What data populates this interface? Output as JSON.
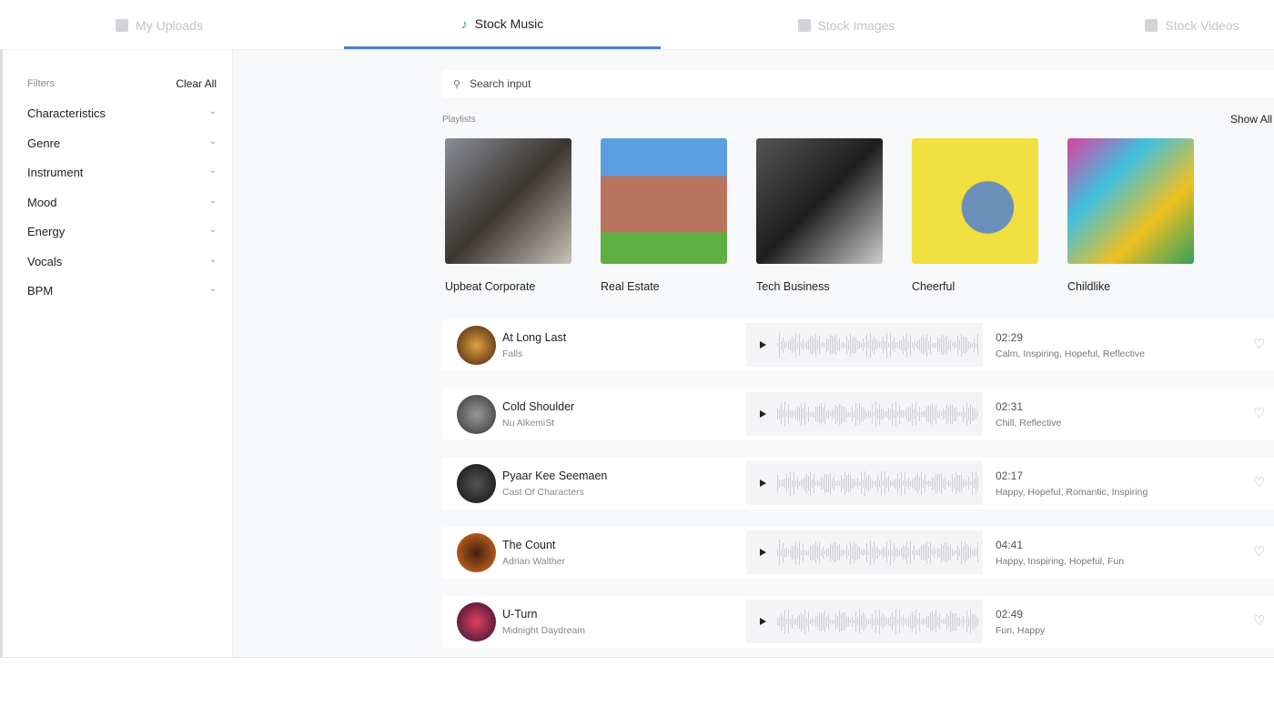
{
  "tabs": [
    {
      "label": "My Uploads",
      "icon": "upload-folder-icon"
    },
    {
      "label": "Stock Music",
      "icon": "music-note-icon",
      "active": true
    },
    {
      "label": "Stock Images",
      "icon": "image-icon"
    },
    {
      "label": "Stock Videos",
      "icon": "video-icon"
    }
  ],
  "accent": "#4a7fe0",
  "filters": {
    "title": "Filters",
    "clear": "Clear All",
    "items": [
      "Characteristics",
      "Genre",
      "Instrument",
      "Mood",
      "Energy",
      "Vocals",
      "BPM"
    ]
  },
  "search": {
    "placeholder": "Search input"
  },
  "playlists": {
    "label": "Playlists",
    "show_all": "Show All",
    "items": [
      "Upbeat Corporate",
      "Real Estate",
      "Tech Business",
      "Cheerful",
      "Childlike"
    ]
  },
  "tracks": [
    {
      "title": "At Long Last",
      "artist": "Falls",
      "duration": "02:29",
      "tags": "Calm, Inspiring, Hopeful, Reflective"
    },
    {
      "title": "Cold Shoulder",
      "artist": "Nu AlkemiSt",
      "duration": "02:31",
      "tags": "Chill, Reflective"
    },
    {
      "title": "Pyaar Kee Seemaen",
      "artist": "Cast Of Characters",
      "duration": "02:17",
      "tags": "Happy, Hopeful, Romantic, Inspiring"
    },
    {
      "title": "The Count",
      "artist": "Adrian Walther",
      "duration": "04:41",
      "tags": "Happy, Inspiring, Hopeful, Fun"
    },
    {
      "title": "U-Turn",
      "artist": "Midnight Daydream",
      "duration": "02:49",
      "tags": "Fun, Happy"
    }
  ]
}
